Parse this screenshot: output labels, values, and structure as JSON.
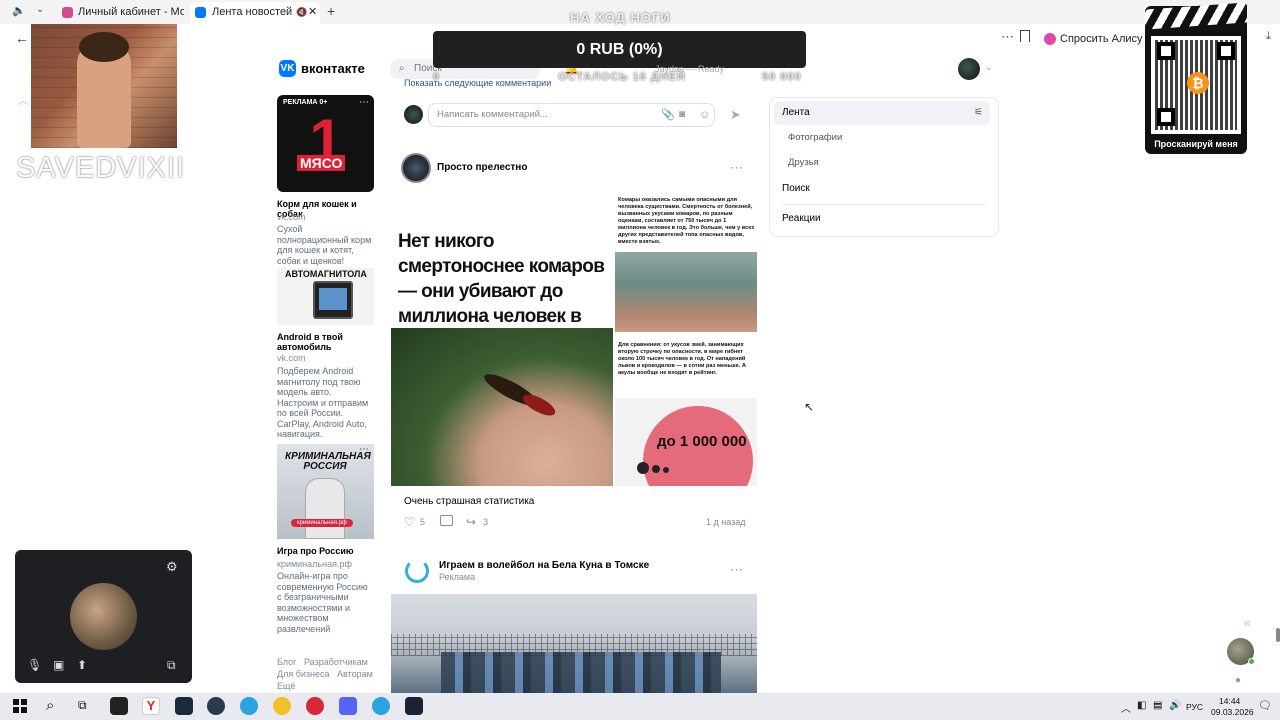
{
  "browser": {
    "tabs": [
      {
        "label": "Личный кабинет - Мои об"
      },
      {
        "label": "Лента новостей"
      }
    ],
    "new_tab": "+",
    "ask_alice": "Спросить Алису А"
  },
  "vk": {
    "logo_text": "вконтакте",
    "search_placeholder": "Поиск",
    "show_next_comments": "Показать следующие комментарии",
    "comment_placeholder": "Написать комментарий..."
  },
  "sidebar_ads": [
    {
      "label": "РЕКЛАМА 0+",
      "img_text": "МЯСО",
      "title": "Корм для кошек и собак",
      "domain": "vk.com",
      "text": "Сухой полнорационный корм для кошек и котят, собак и щенков!"
    },
    {
      "img_text": "АВТОМАГНИТОЛА",
      "title": "Android в твой автомобиль",
      "domain": "vk.com",
      "text": "Подберем Android магнитолу под твою модель авто. Настроим и отправим по всей России. CarPlay, Android Auto, навигация."
    },
    {
      "img_text": "КРИМИНАЛЬНАЯ РОССИЯ",
      "img_site": "криминальная.рф",
      "title": "Игра про Россию",
      "domain": "криминальная.рф",
      "text": "Онлайн-игра про современную Россию с безграничными возможностями и множеством развлечений"
    }
  ],
  "footer_links": [
    "Блог",
    "Разработчикам",
    "Для бизнеса",
    "Авторам",
    "Ещё"
  ],
  "post": {
    "author": "Просто прелестно",
    "headline": "Нет никого смертоноснее комаров — они убивают до миллиона человек в год",
    "side_text_1": "Комары оказались самыми опасными для человека существами. Смертность от болезней, вызванных укусами комаров, по разным оценкам, составляет от 750 тысяч до 1 миллиона человек в год. Это больше, чем у всех других представителей топа опасных видов, вместе взятых.",
    "side_text_2": "Для сравнения: от укусов змей, занимающих вторую строчку по опасности, в мире гибнет около 100 тысяч человек в год. От нападений львов и крокодилов — в сотни раз меньше. А акулы вообще не входят в рейтинг.",
    "chart_label": "до 1 000 000",
    "caption": "Очень страшная статистика",
    "likes": "5",
    "shares": "3",
    "time": "1 д назад"
  },
  "post2": {
    "author": "Играем в волейбол на Бела Куна в Томске",
    "sub": "Реклама"
  },
  "right_menu": {
    "items": [
      "Лента",
      "Фотографии",
      "Друзья",
      "Поиск",
      "Реакции"
    ]
  },
  "stream_overlay": {
    "top_text": "НА ХОД НОГИ",
    "donation": "0 RUB (0%)",
    "left_num": "0",
    "days_left": "ОСТАЛОСЬ 16 ДНЕЙ",
    "goal": "50 000",
    "track": "Jaydan — Ready",
    "channel_name": "SAVEDVIXII",
    "qr_caption": "Просканируй меня"
  },
  "taskbar": {
    "lang": "РУС",
    "time": "14:44",
    "date": "09.03.2026"
  },
  "colors": {
    "vk_blue": "#0077ff",
    "taskbar_bg": "#e8eaf0",
    "donation_bg": "#202020",
    "chart_pink": "#e66b7a"
  }
}
